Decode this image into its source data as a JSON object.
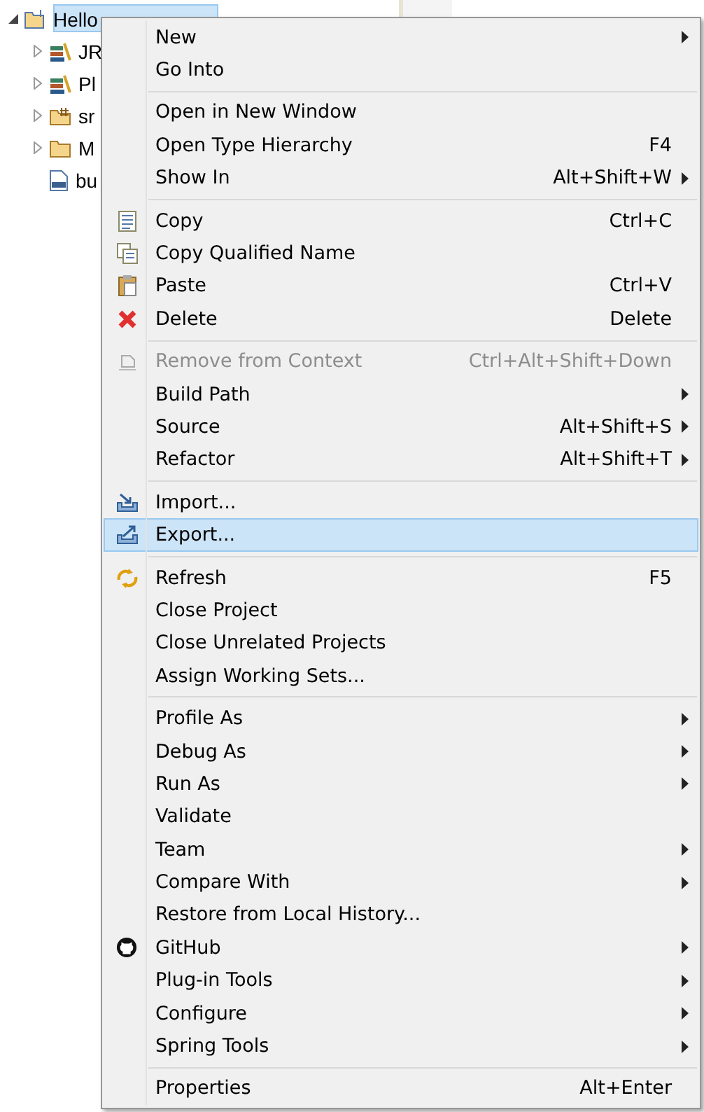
{
  "tree": {
    "items": [
      {
        "label": "Hello",
        "kind": "project",
        "expanded": true,
        "selected": true,
        "children": [
          {
            "label": "JR",
            "kind": "library",
            "expanded": false,
            "selected": false
          },
          {
            "label": "Pl",
            "kind": "library",
            "expanded": false,
            "selected": false
          },
          {
            "label": "sr",
            "kind": "package-folder",
            "expanded": false,
            "selected": false
          },
          {
            "label": "M",
            "kind": "folder",
            "expanded": false,
            "selected": false
          },
          {
            "label": "bu",
            "kind": "binary-file",
            "selected": false
          }
        ]
      }
    ]
  },
  "context_menu": {
    "groups": [
      [
        {
          "label": "New",
          "submenu": true,
          "selected": false,
          "disabled": false
        },
        {
          "label": "Go Into",
          "selected": false,
          "disabled": false
        }
      ],
      [
        {
          "label": "Open in New Window",
          "selected": false,
          "disabled": false
        },
        {
          "label": "Open Type Hierarchy",
          "shortcut": "F4",
          "selected": false,
          "disabled": false
        },
        {
          "label": "Show In",
          "shortcut": "Alt+Shift+W",
          "submenu": true,
          "selected": false,
          "disabled": false
        }
      ],
      [
        {
          "label": "Copy",
          "kind": "copy",
          "shortcut": "Ctrl+C",
          "selected": false,
          "disabled": false
        },
        {
          "label": "Copy Qualified Name",
          "kind": "copy-qualified",
          "selected": false,
          "disabled": false
        },
        {
          "label": "Paste",
          "kind": "paste",
          "shortcut": "Ctrl+V",
          "selected": false,
          "disabled": false
        },
        {
          "label": "Delete",
          "kind": "delete",
          "shortcut": "Delete",
          "selected": false,
          "disabled": false
        }
      ],
      [
        {
          "label": "Remove from Context",
          "kind": "remove-context",
          "shortcut": "Ctrl+Alt+Shift+Down",
          "selected": false,
          "disabled": true
        },
        {
          "label": "Build Path",
          "submenu": true,
          "selected": false,
          "disabled": false
        },
        {
          "label": "Source",
          "shortcut": "Alt+Shift+S",
          "submenu": true,
          "selected": false,
          "disabled": false
        },
        {
          "label": "Refactor",
          "shortcut": "Alt+Shift+T",
          "submenu": true,
          "selected": false,
          "disabled": false
        }
      ],
      [
        {
          "label": "Import...",
          "kind": "import",
          "selected": false,
          "disabled": false
        },
        {
          "label": "Export...",
          "kind": "export",
          "selected": true,
          "disabled": false
        }
      ],
      [
        {
          "label": "Refresh",
          "kind": "refresh",
          "shortcut": "F5",
          "selected": false,
          "disabled": false
        },
        {
          "label": "Close Project",
          "selected": false,
          "disabled": false
        },
        {
          "label": "Close Unrelated Projects",
          "selected": false,
          "disabled": false
        },
        {
          "label": "Assign Working Sets...",
          "selected": false,
          "disabled": false
        }
      ],
      [
        {
          "label": "Profile As",
          "submenu": true,
          "selected": false,
          "disabled": false
        },
        {
          "label": "Debug As",
          "submenu": true,
          "selected": false,
          "disabled": false
        },
        {
          "label": "Run As",
          "submenu": true,
          "selected": false,
          "disabled": false
        },
        {
          "label": "Validate",
          "selected": false,
          "disabled": false
        },
        {
          "label": "Team",
          "submenu": true,
          "selected": false,
          "disabled": false
        },
        {
          "label": "Compare With",
          "submenu": true,
          "selected": false,
          "disabled": false
        },
        {
          "label": "Restore from Local History...",
          "selected": false,
          "disabled": false
        },
        {
          "label": "GitHub",
          "kind": "github",
          "submenu": true,
          "selected": false,
          "disabled": false
        },
        {
          "label": "Plug-in Tools",
          "submenu": true,
          "selected": false,
          "disabled": false
        },
        {
          "label": "Configure",
          "submenu": true,
          "selected": false,
          "disabled": false
        },
        {
          "label": "Spring Tools",
          "submenu": true,
          "selected": false,
          "disabled": false
        }
      ],
      [
        {
          "label": "Properties",
          "shortcut": "Alt+Enter",
          "selected": false,
          "disabled": false
        }
      ]
    ]
  }
}
